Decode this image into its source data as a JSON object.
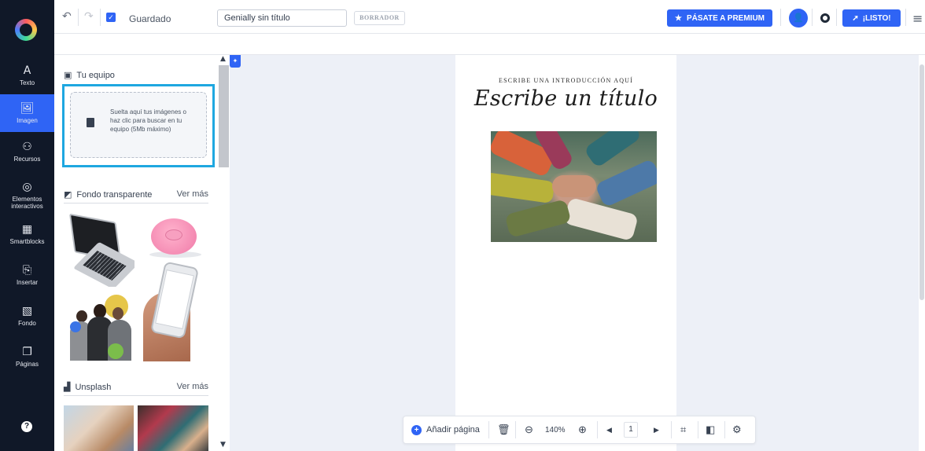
{
  "topbar": {
    "undo_icon": "undo-icon",
    "redo_icon": "redo-icon",
    "saved_label": "Guardado",
    "title_value": "Genially sin título",
    "draft_badge": "BORRADOR",
    "premium_label": "PÁSATE A PREMIUM",
    "listo_label": "¡LISTO!"
  },
  "rail": {
    "items": [
      {
        "label": "Texto",
        "icon": "A"
      },
      {
        "label": "Imagen",
        "icon": "🖼"
      },
      {
        "label": "Recursos",
        "icon": "⚇"
      },
      {
        "label": "Elementos interactivos",
        "icon": "◎"
      },
      {
        "label": "Smartblocks",
        "icon": "▦"
      },
      {
        "label": "Insertar",
        "icon": "⎘"
      },
      {
        "label": "Fondo",
        "icon": "▧"
      },
      {
        "label": "Páginas",
        "icon": "❐"
      }
    ],
    "help": "?"
  },
  "panel": {
    "tu_equipo": "Tu equipo",
    "upload_text": "Suelta aquí tus imágenes o haz clic para buscar en tu equipo (5Mb máximo)",
    "fondo_transparente": "Fondo transparente",
    "ver_mas": "Ver más",
    "unsplash": "Unsplash",
    "ver_mas_2": "Ver más"
  },
  "canvas": {
    "intro": "ESCRIBE UNA INTRODUCCIÓN AQUÍ",
    "title": "Escribe un título"
  },
  "bottom_toolbar": {
    "add_page": "Añadir página",
    "zoom": "140%",
    "page_number": "1"
  },
  "colors": {
    "accent": "#2f64f5",
    "rail_bg": "#101828",
    "highlight": "#1ea7e0",
    "canvas_bg": "#edf0f7"
  }
}
